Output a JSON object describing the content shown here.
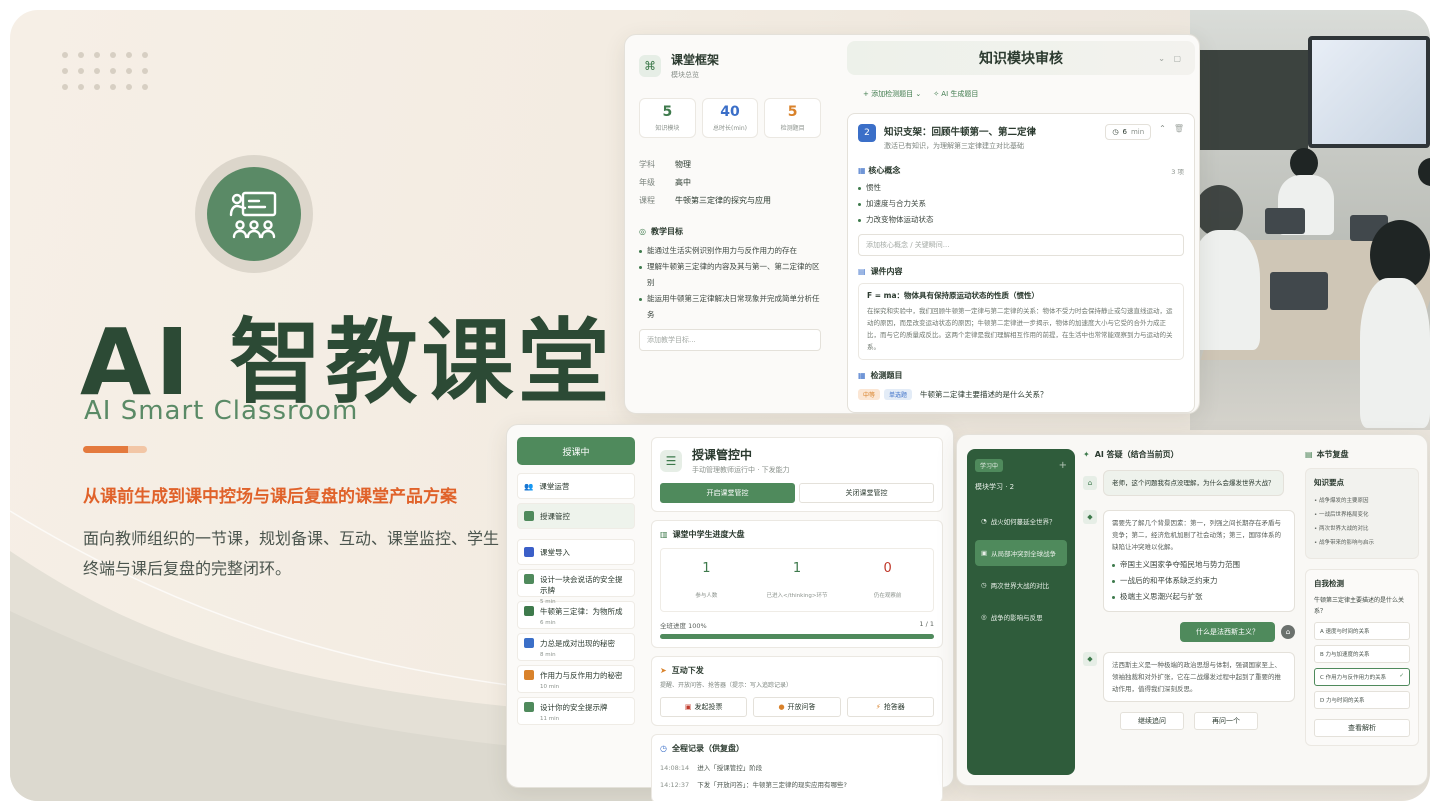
{
  "hero": {
    "title": "AI 智教课堂",
    "subtitle": "AI Smart Classroom",
    "tagline": "从课前生成到课中控场与课后复盘的课堂产品方案",
    "description": "面向教师组织的一节课，规划备课、互动、课堂监控、学生终端与课后复盘的完整闭环。"
  },
  "framework": {
    "title": "课堂框架",
    "subtitle": "模块总览",
    "stats": [
      {
        "value": "5",
        "label": "知识模块",
        "color": "#3e7a4c"
      },
      {
        "value": "40",
        "label": "总时长(min)",
        "color": "#3b6fc8"
      },
      {
        "value": "5",
        "label": "检测题目",
        "color": "#d9822b"
      }
    ],
    "info": [
      {
        "key": "学科",
        "value": "物理"
      },
      {
        "key": "年级",
        "value": "高中"
      },
      {
        "key": "课程",
        "value": "牛顿第三定律的探究与应用"
      }
    ],
    "goals_title": "教学目标",
    "goals": [
      "能通过生活实例识别作用力与反作用力的存在",
      "理解牛顿第三定律的内容及其与第一、第二定律的区别",
      "能运用牛顿第三定律解决日常现象并完成简单分析任务"
    ],
    "goal_placeholder": "添加教学目标..."
  },
  "review": {
    "title": "知识模块审核",
    "add_question": "添加检测题目",
    "ai_generate": "AI 生成题目",
    "module": {
      "index": "2",
      "title": "知识支架：回顾牛顿第一、第二定律",
      "subtitle": "激活已有知识，为理解第三定律建立对比基础",
      "minutes": "6",
      "unit": "min",
      "concept_title": "核心概念",
      "concept_count": "3 项",
      "concepts": [
        "惯性",
        "加速度与合力关系",
        "力改变物体运动状态"
      ],
      "concept_placeholder": "添加核心概念 / 关键瞬间...",
      "content_title": "课件内容",
      "content_heading": "F = ma：物体具有保持原运动状态的性质（惯性）",
      "content_body": "在探究和实验中，我们回顾牛顿第一定律与第二定律的关系：物体不受力时会保持静止或匀速直线运动，运动的原因，而是改变运动状态的原因；牛顿第二定律进一步揭示，物体的加速度大小与它受的合外力成正比，而与它的质量成反比。这两个定律是我们理解相互作用的前提，在生活中也常常能观察到力与运动的关系。",
      "question_title": "检测题目",
      "question_level": "中等",
      "question_type": "单选题",
      "question_text": "牛顿第二定律主要描述的是什么关系？"
    }
  },
  "control": {
    "status_button": "授课中",
    "nav": [
      {
        "label": "课堂运营",
        "sub": ""
      },
      {
        "label": "授课管控",
        "sub": ""
      },
      {
        "label": "课堂导入",
        "sub": ""
      },
      {
        "label": "设计一块会说话的安全提示牌",
        "sub": "5 min"
      },
      {
        "label": "牛顿第三定律：为物所成",
        "sub": "6 min"
      },
      {
        "label": "力总是成对出现的秘密",
        "sub": "8 min"
      },
      {
        "label": "作用力与反作用力的秘密",
        "sub": "10 min"
      },
      {
        "label": "设计你的安全提示牌",
        "sub": "11 min"
      }
    ],
    "title": "授课管控中",
    "subtitle": "手动管理教师运行中 · 下发能力",
    "toggle_on": "开启课堂管控",
    "toggle_off": "关闭课堂管控",
    "board_title": "课堂中学生进度大盘",
    "board_stats": [
      {
        "value": "1",
        "label": "参与人数",
        "color": "#3e7a4c"
      },
      {
        "value": "1",
        "label": "已进入</thinking>环节",
        "color": "#3e7a4c"
      },
      {
        "value": "0",
        "label": "仍在观察前",
        "color": "#c0392b"
      }
    ],
    "progress_label": "全班进度 100%",
    "progress_count": "1 / 1",
    "progress": 1.0,
    "interact_title": "互动下发",
    "interact_sub": "提醒、开放问答、抢答器（提示：写入追踪记录）",
    "actions": [
      "发起投票",
      "开放问答",
      "抢答器"
    ],
    "log_title": "全程记录（供复盘）",
    "log": [
      {
        "time": "14:08:14",
        "text": "进入「授课管控」阶段"
      },
      {
        "time": "14:12:37",
        "text": "下发「开放问答」：牛顿第三定律的现实应用有哪些?"
      }
    ]
  },
  "student": {
    "tag": "学习中",
    "module": "模块学习 · 2",
    "items": [
      "战火如何蔓延全世界？",
      "从局部冲突到全球战争",
      "两次世界大战的对比",
      "战争的影响与反思"
    ],
    "chat_title": "AI 答疑（结合当前页）",
    "question": "老师，这个问题我有点没理解，为什么会爆发世界大战？",
    "answer1": "需要先了解几个背景因素：第一，列强之间长期存在矛盾与竞争；第二，经济危机加剧了社会动荡；第三，国际体系的缺陷让冲突难以化解。",
    "answer_points": [
      "帝国主义国家争夺殖民地与势力范围",
      "一战后的和平体系缺乏约束力",
      "极端主义思潮兴起与扩张"
    ],
    "pill_question": "什么是法西斯主义？",
    "answer2": "法西斯主义是一种极端的政治思想与体制，强调国家至上、领袖独裁和对外扩张，它在二战爆发过程中起到了重要的推动作用，值得我们深刻反思。",
    "btn_follow": "继续追问",
    "btn_again": "再问一个",
    "recap_title": "本节复盘",
    "points_title": "知识要点",
    "points": [
      "战争爆发的主要原因",
      "一战后世界格局变化",
      "两次世界大战的对比",
      "战争带来的影响与启示"
    ],
    "quiz_title": "自我检测",
    "quiz_question": "牛顿第三定律主要描述的是什么关系？",
    "options": [
      "A  速度与时间的关系",
      "B  力与加速度的关系",
      "C  作用力与反作用力的关系",
      "D  力与时间的关系"
    ],
    "selected": 2,
    "check_button": "查看解析"
  }
}
